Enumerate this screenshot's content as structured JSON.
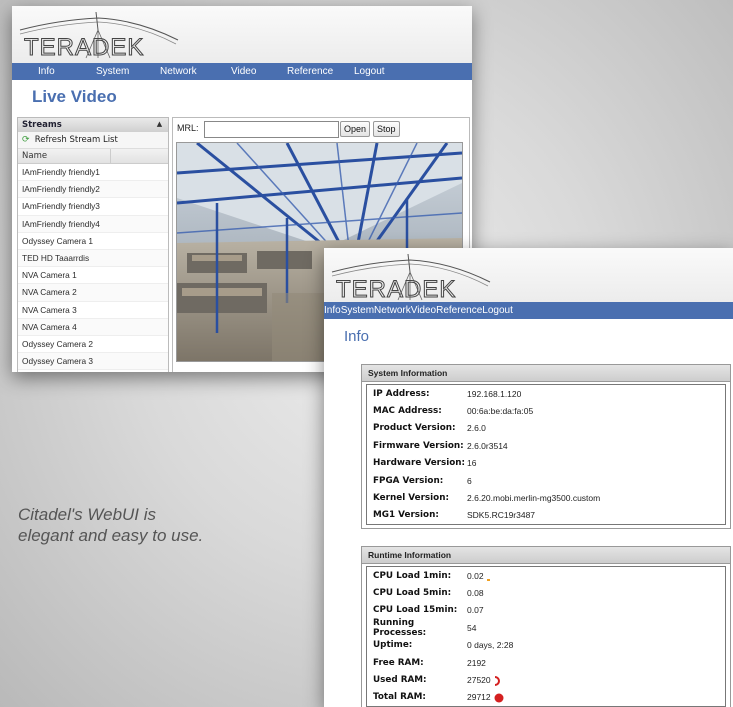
{
  "caption": {
    "line1": "Citadel's WebUI is",
    "line2": "elegant and easy to use."
  },
  "live_video_screen": {
    "logo_text": "TERADEK",
    "nav": [
      "Info",
      "System",
      "Network",
      "Video",
      "Reference",
      "Logout"
    ],
    "page_title": "Live Video",
    "streams": {
      "header": "Streams",
      "refresh_label": "Refresh Stream List",
      "name_column": "Name",
      "items": [
        "IAmFriendly friendly1",
        "IAmFriendly friendly2",
        "IAmFriendly friendly3",
        "IAmFriendly friendly4",
        "Odyssey Camera 1",
        "TED HD Taaarrdis",
        "NVA Camera 1",
        "NVA Camera 2",
        "NVA Camera 3",
        "NVA Camera 4",
        "Odyssey Camera 2",
        "Odyssey Camera 3"
      ]
    },
    "player": {
      "mrl_label": "MRL:",
      "mrl_value": "",
      "open_label": "Open",
      "stop_label": "Stop"
    }
  },
  "info_screen": {
    "logo_text": "TERADEK",
    "nav": [
      "Info",
      "System",
      "Network",
      "Video",
      "Reference",
      "Logout"
    ],
    "page_title": "Info",
    "system_information": {
      "header": "System Information",
      "rows": [
        {
          "label": "IP Address:",
          "value": "192.168.1.120"
        },
        {
          "label": "MAC Address:",
          "value": "00:6a:be:da:fa:05"
        },
        {
          "label": "Product Version:",
          "value": "2.6.0"
        },
        {
          "label": "Firmware Version:",
          "value": "2.6.0r3514"
        },
        {
          "label": "Hardware Version:",
          "value": "16"
        },
        {
          "label": "FPGA Version:",
          "value": "6"
        },
        {
          "label": "Kernel Version:",
          "value": "2.6.20.mobi.merlin-mg3500.custom"
        },
        {
          "label": "MG1 Version:",
          "value": "SDK5.RC19r3487"
        }
      ]
    },
    "runtime_information": {
      "header": "Runtime Information",
      "rows": [
        {
          "label": "CPU Load 1min:",
          "value": "0.02"
        },
        {
          "label": "CPU Load 5min:",
          "value": "0.08"
        },
        {
          "label": "CPU Load 15min:",
          "value": "0.07"
        },
        {
          "label": "Running Processes:",
          "value": "54"
        },
        {
          "label": "Uptime:",
          "value": "0 days, 2:28"
        },
        {
          "label": "Free RAM:",
          "value": "2192"
        },
        {
          "label": "Used RAM:",
          "value": "27520"
        },
        {
          "label": "Total RAM:",
          "value": "29712"
        }
      ]
    },
    "colors": {
      "nav_bar": "#4a6fb0",
      "cpu_indicator": "#f0a020",
      "ram_indicator": "#d42020"
    }
  }
}
